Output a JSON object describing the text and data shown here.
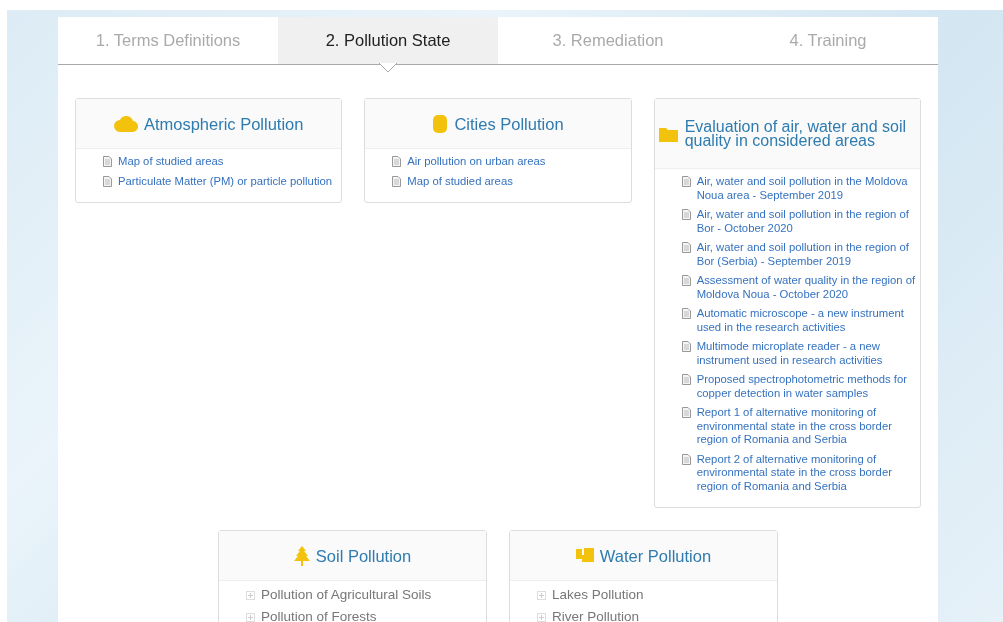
{
  "tabs": [
    {
      "label": "1. Terms Definitions",
      "selected": false
    },
    {
      "label": "2. Pollution State",
      "selected": true
    },
    {
      "label": "3. Remediation",
      "selected": false
    },
    {
      "label": "4. Training",
      "selected": false
    }
  ],
  "card_rows": [
    [
      {
        "title": "Atmospheric Pollution",
        "items": [
          {
            "kind": "document",
            "label": "Map of studied areas"
          },
          {
            "kind": "document",
            "label": "Particulate Matter (PM) or particle pollution"
          }
        ]
      },
      {
        "title": "Cities Pollution",
        "items": [
          {
            "kind": "document",
            "label": "Air pollution on urban areas"
          },
          {
            "kind": "document",
            "label": "Map of studied areas"
          }
        ]
      },
      {
        "title": "Evaluation of air, water and soil quality in considered areas",
        "items": [
          {
            "kind": "document",
            "label": "Air, water and soil pollution in the Moldova Noua area - September 2019"
          },
          {
            "kind": "document",
            "label": "Air, water and soil pollution in the region of Bor - October 2020"
          },
          {
            "kind": "document",
            "label": "Air, water and soil pollution in the region of Bor (Serbia) - September 2019"
          },
          {
            "kind": "document",
            "label": "Assessment of water quality in the region of Moldova Noua - October 2020"
          },
          {
            "kind": "document",
            "label": "Automatic microscope - a new instrument used in the research activities"
          },
          {
            "kind": "document",
            "label": "Multimode microplate reader - a new instrument used in research activities"
          },
          {
            "kind": "document",
            "label": "Proposed spectrophotometric methods for copper detection in water samples"
          },
          {
            "kind": "document",
            "label": "Report 1 of alternative monitoring of environmental state in the cross border region of Romania and Serbia"
          },
          {
            "kind": "document",
            "label": "Report 2 of alternative monitoring of environmental state in the cross border region of Romania and Serbia"
          }
        ]
      }
    ],
    [
      {
        "title": "Soil Pollution",
        "items": [
          {
            "kind": "section",
            "label": "Pollution of Agricultural Soils"
          },
          {
            "kind": "section",
            "label": "Pollution of Forests"
          }
        ]
      },
      {
        "title": "Water Pollution",
        "items": [
          {
            "kind": "section",
            "label": "Lakes Pollution"
          },
          {
            "kind": "section",
            "label": "River Pollution"
          }
        ]
      }
    ]
  ]
}
